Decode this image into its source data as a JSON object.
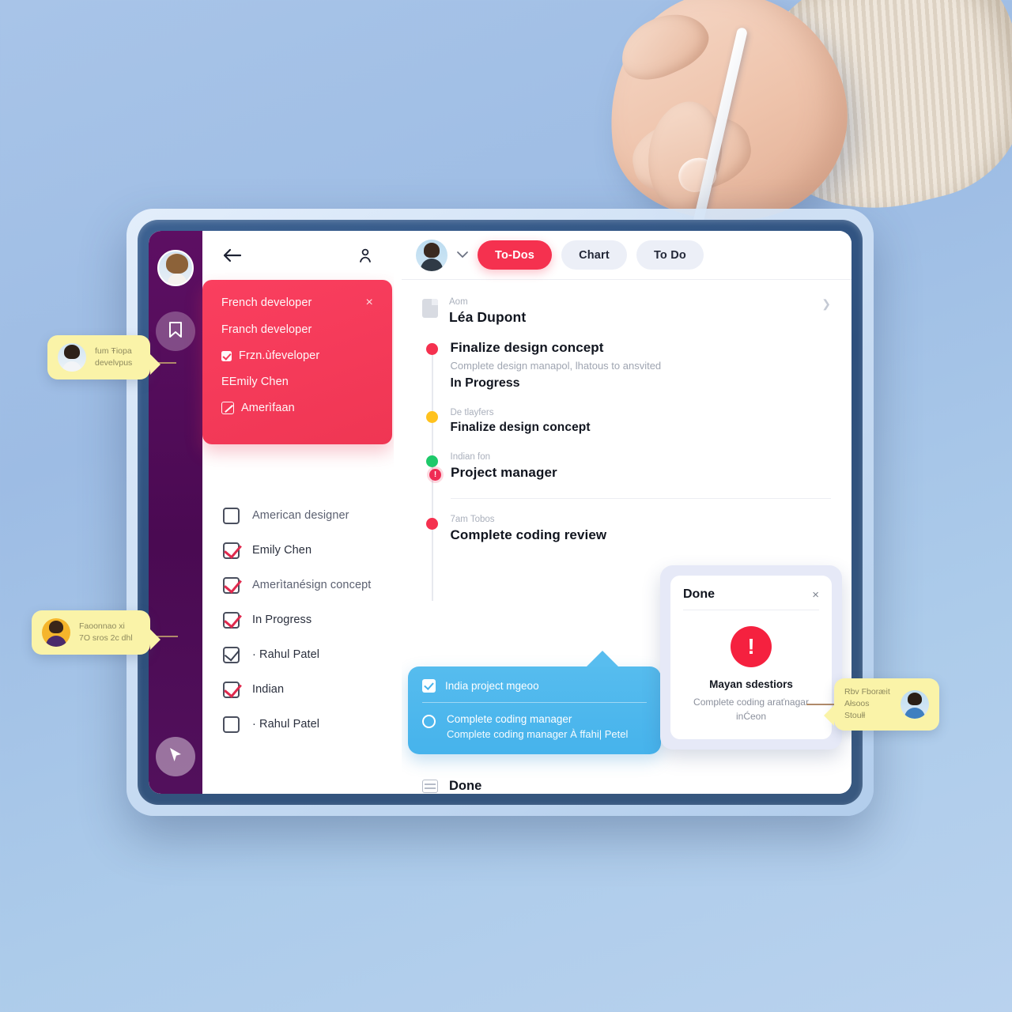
{
  "scene": {
    "device": "tablet",
    "hand_holding_stylus": true,
    "background_color": "#a8c4e8",
    "bezel_color": "#2d4f7c"
  },
  "left_panel": {
    "sidebar": {
      "avatar_name": "user-avatar",
      "top_icon": "bookmark-icon",
      "bottom_icon": "cursor-pointer-icon"
    },
    "header": {
      "back_icon": "back-arrow-icon",
      "person_icon": "person-icon"
    },
    "dropdown": {
      "close_label": "×",
      "rows": [
        {
          "label": "French developer",
          "type": "plain"
        },
        {
          "label": "Franch developer",
          "type": "plain"
        },
        {
          "label": "Frzn.ùfeveloper",
          "type": "checkbox"
        },
        {
          "label": "EEmily Chen",
          "type": "plain"
        },
        {
          "label": "Amerìfaan",
          "type": "edit"
        }
      ]
    },
    "checklist": [
      {
        "label": "American designer",
        "checked": false,
        "check_color": "none"
      },
      {
        "label": "Emily Chen",
        "checked": true,
        "check_color": "red"
      },
      {
        "label": "Amerìtanésign concept",
        "checked": true,
        "check_color": "red"
      },
      {
        "label": "In Progress",
        "checked": true,
        "check_color": "red"
      },
      {
        "label": "· Rahul Patel",
        "checked": true,
        "check_color": "dark"
      },
      {
        "label": "Indian",
        "checked": true,
        "check_color": "red"
      },
      {
        "label": "· Rahul Patel",
        "checked": false,
        "check_color": "none"
      }
    ]
  },
  "right_panel": {
    "header": {
      "avatar_name": "user-avatar",
      "chevron_icon": "chevron-down-icon",
      "tabs": [
        {
          "label": "To-Dos",
          "active": true
        },
        {
          "label": "Chart",
          "active": false
        },
        {
          "label": "To Do",
          "active": false
        }
      ]
    },
    "timeline_header": {
      "icon": "document-icon",
      "sub_label": "Aom",
      "name": "Léa Dupont",
      "arrow_icon": "chevron-right-icon"
    },
    "timeline": [
      {
        "dot_color": "#f5314f",
        "label": "",
        "title": "Finalize design concept",
        "description": "Complete design manapol, lhatous to ansvited",
        "status": "In Progress"
      },
      {
        "dot_color": "#ffc21e",
        "label": "De tlayfers",
        "title": "Finalize design concept",
        "description": "",
        "status": ""
      },
      {
        "dot_color": "#1ec96a",
        "label": "Indian fon",
        "title": "Project manager",
        "description": "",
        "status": "",
        "alert_dot": true
      },
      {
        "dot_color": "#ef2c54",
        "label": "7am Tobos",
        "title": "Complete coding review",
        "description": "",
        "status": ""
      }
    ],
    "done_row": {
      "icon": "mail-icon",
      "label": "Done"
    },
    "blue_card": {
      "check_icon": "checkbox-checked-icon",
      "top_text": "India project mgeoo",
      "radio_icon": "radio-unchecked-icon",
      "line1": "Complete coding manager",
      "line2": "Complete coding manager À ffahi| Petel"
    },
    "done_modal": {
      "title": "Done",
      "close_label": "×",
      "badge_icon": "alert-exclamation-icon",
      "badge_glyph": "!",
      "badge_color": "#f5213f",
      "heading": "Mayan sdestiors",
      "body": "Complete coding araťnagar inĆeon"
    }
  },
  "callouts": [
    {
      "avatar": "person-avatar-1",
      "line1": "fum Ŧiopa",
      "line2": "develvpus",
      "tail": "right"
    },
    {
      "avatar": "person-avatar-2",
      "line1": "Faoonnao  xi",
      "line2": "7O sros 2c dhl",
      "tail": "right"
    },
    {
      "avatar": "person-avatar-3",
      "line1": "Rbv Fboræit",
      "line2": "Ałsoos Stoułł",
      "tail": "left"
    }
  ]
}
